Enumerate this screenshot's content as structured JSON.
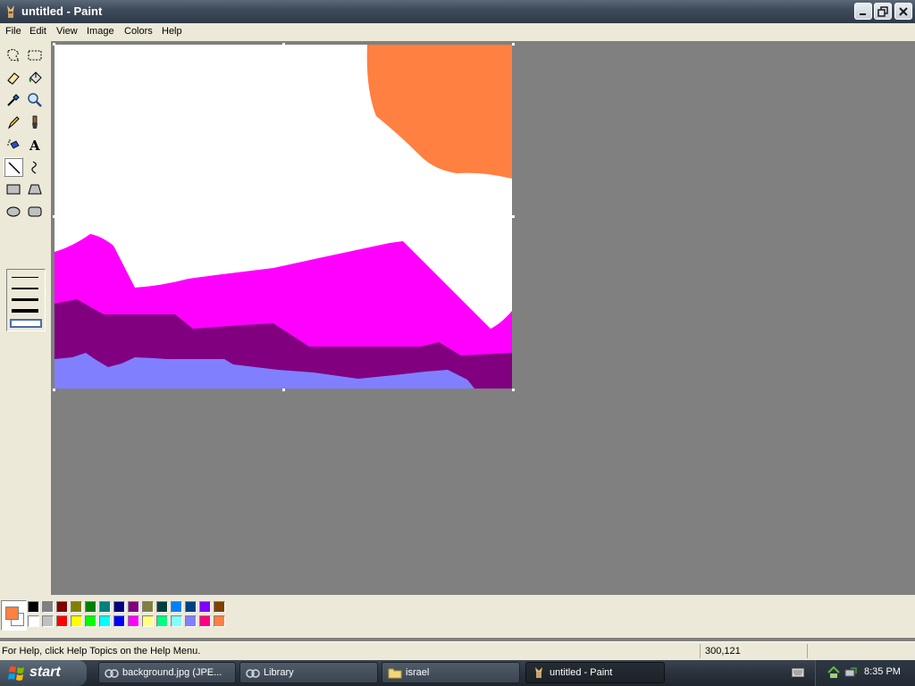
{
  "window": {
    "title": "untitled - Paint"
  },
  "menu": {
    "items": [
      "File",
      "Edit",
      "View",
      "Image",
      "Colors",
      "Help"
    ]
  },
  "tools": [
    "free-form-select",
    "select",
    "eraser",
    "fill-with-color",
    "pick-color",
    "magnifier",
    "pencil",
    "brush",
    "airbrush",
    "text",
    "line",
    "curve",
    "rectangle",
    "polygon",
    "ellipse",
    "rounded-rectangle"
  ],
  "selected_tool": "line",
  "palette": {
    "primary": "#ff8040",
    "secondary": "#ffffff",
    "row1": [
      "#000000",
      "#808080",
      "#800000",
      "#808000",
      "#008000",
      "#008080",
      "#000080",
      "#800080",
      "#808040",
      "#004040",
      "#0080ff",
      "#004080",
      "#8000ff",
      "#804000"
    ],
    "row2": [
      "#ffffff",
      "#c0c0c0",
      "#ff0000",
      "#ffff00",
      "#00ff00",
      "#00ffff",
      "#0000ff",
      "#ff00ff",
      "#ffff80",
      "#00ff80",
      "#80ffff",
      "#8080ff",
      "#ff0080",
      "#ff8040"
    ]
  },
  "status": {
    "help_text": "For Help, click Help Topics on the Help Menu.",
    "coords": "300,121"
  },
  "taskbar": {
    "start_label": "start",
    "tasks": [
      {
        "label": "background.jpg (JPE...",
        "active": false
      },
      {
        "label": "Library",
        "active": false
      },
      {
        "label": "israel",
        "active": false
      },
      {
        "label": "untitled - Paint",
        "active": true
      }
    ],
    "clock": "8:35 PM"
  }
}
